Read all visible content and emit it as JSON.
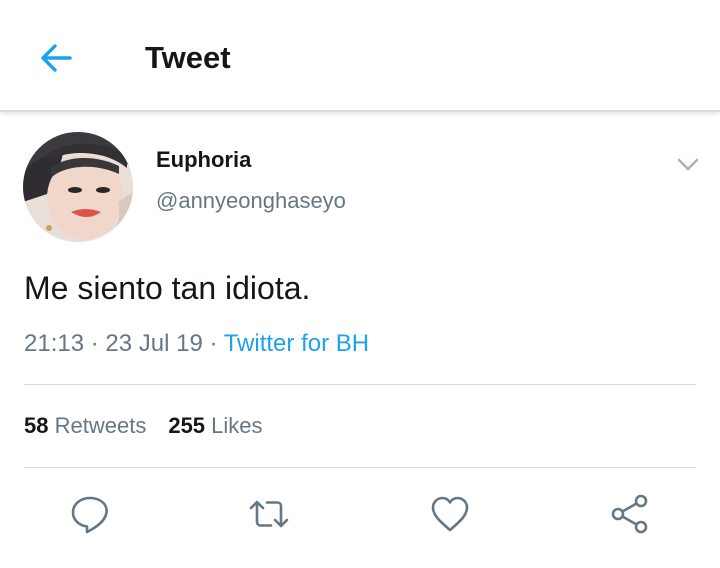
{
  "header": {
    "title": "Tweet",
    "back_icon": "arrow-left-icon",
    "accent_color": "#1da1f2"
  },
  "tweet": {
    "author": {
      "display_name": "Euphoria",
      "handle": "@annyeonghaseyo",
      "avatar_icon": "profile-photo"
    },
    "menu_icon": "chevron-down-icon",
    "text": "Me siento tan idiota.",
    "time": "21:13",
    "separator": "·",
    "date": "23 Jul 19",
    "source": "Twitter for BH",
    "stats": {
      "retweets_count": "58",
      "retweets_label": "Retweets",
      "likes_count": "255",
      "likes_label": "Likes"
    },
    "actions": [
      {
        "icon": "reply-icon"
      },
      {
        "icon": "retweet-icon"
      },
      {
        "icon": "heart-icon"
      },
      {
        "icon": "share-icon"
      }
    ]
  },
  "colors": {
    "text_primary": "#14171a",
    "text_secondary": "#657786",
    "link": "#1da1f2",
    "divider": "#d7dbdf"
  }
}
